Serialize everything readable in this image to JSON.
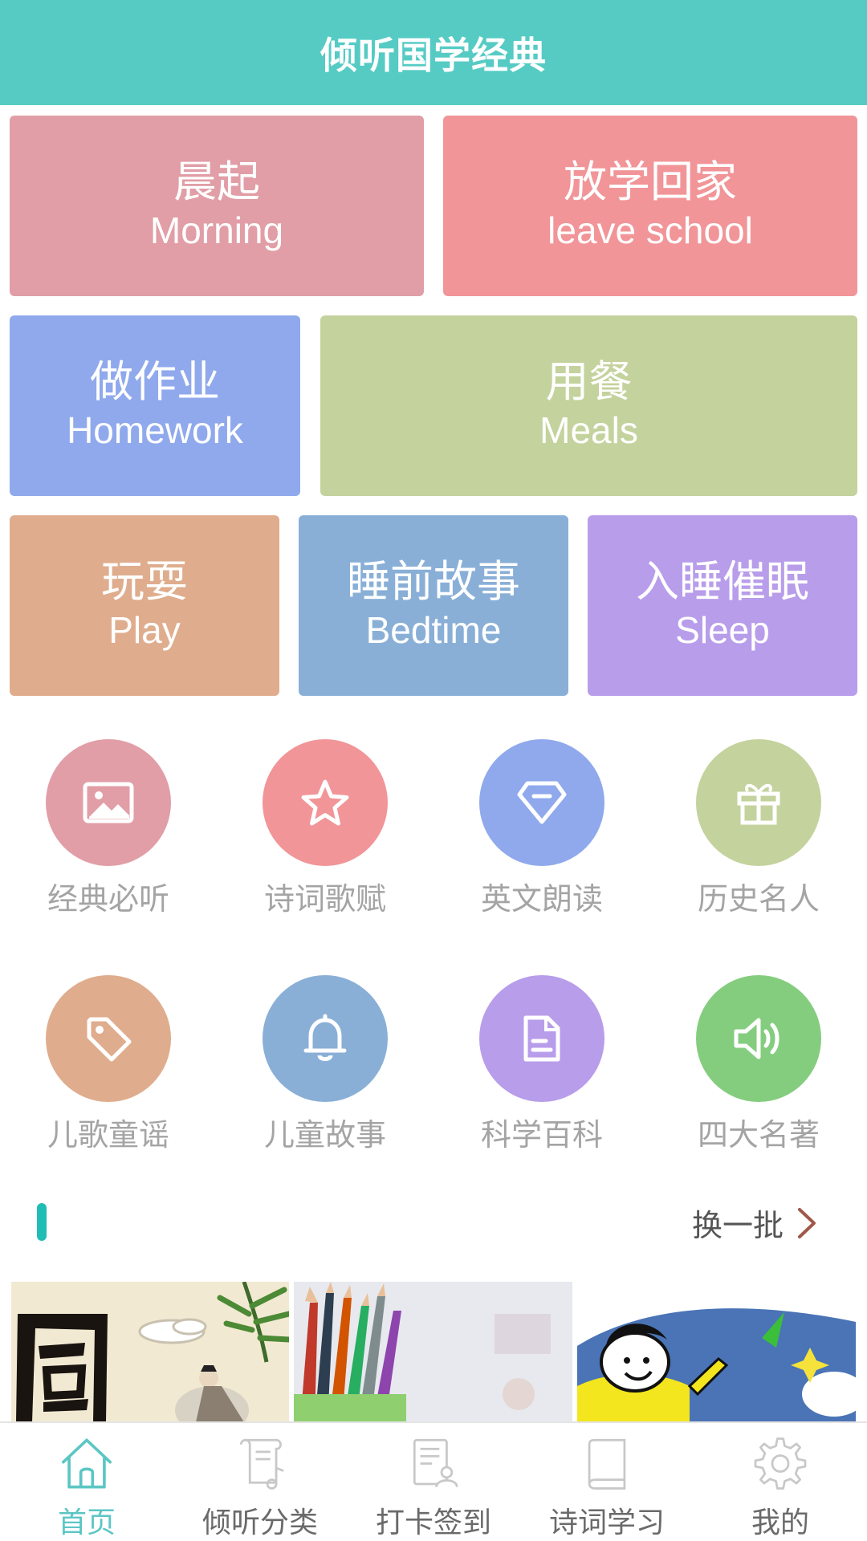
{
  "header": {
    "title": "倾听国学经典"
  },
  "scenes": [
    {
      "zh": "晨起",
      "en": "Morning",
      "color": "#e19ea6"
    },
    {
      "zh": "放学回家",
      "en": "leave school",
      "color": "#f19598"
    },
    {
      "zh": "做作业",
      "en": "Homework",
      "color": "#8fa9ec"
    },
    {
      "zh": "用餐",
      "en": "Meals",
      "color": "#c4d29d"
    },
    {
      "zh": "玩耍",
      "en": "Play",
      "color": "#dfad8d"
    },
    {
      "zh": "睡前故事",
      "en": "Bedtime",
      "color": "#89afd7"
    },
    {
      "zh": "入睡催眠",
      "en": "Sleep",
      "color": "#b89dea"
    }
  ],
  "categories": [
    {
      "label": "经典必听",
      "icon": "image-icon",
      "color": "#e19ea6"
    },
    {
      "label": "诗词歌赋",
      "icon": "star-icon",
      "color": "#f19598"
    },
    {
      "label": "英文朗读",
      "icon": "diamond-icon",
      "color": "#8fa9ec"
    },
    {
      "label": "历史名人",
      "icon": "gift-icon",
      "color": "#c4d29d"
    },
    {
      "label": "儿歌童谣",
      "icon": "tag-icon",
      "color": "#dfad8d"
    },
    {
      "label": "儿童故事",
      "icon": "bell-icon",
      "color": "#89afd7"
    },
    {
      "label": "科学百科",
      "icon": "document-icon",
      "color": "#b89dea"
    },
    {
      "label": "四大名著",
      "icon": "speaker-icon",
      "color": "#84cd7f"
    }
  ],
  "section": {
    "refresh_label": "换一批",
    "accent_color": "#1fbdb4"
  },
  "thumbnails": [
    {
      "name": "guoxue-calligraphy-thumbnail"
    },
    {
      "name": "pencils-thumbnail"
    },
    {
      "name": "cartoon-girl-thumbnail"
    }
  ],
  "tabs": [
    {
      "label": "首页",
      "icon": "home-icon",
      "active": true
    },
    {
      "label": "倾听分类",
      "icon": "scroll-music-icon",
      "active": false
    },
    {
      "label": "打卡签到",
      "icon": "checkin-icon",
      "active": false
    },
    {
      "label": "诗词学习",
      "icon": "book-icon",
      "active": false
    },
    {
      "label": "我的",
      "icon": "gear-icon",
      "active": false
    }
  ],
  "theme": {
    "header_color": "#56cbc4",
    "active_tab_color": "#5cc6c4",
    "inactive_tab_color": "#c8c8c8"
  }
}
